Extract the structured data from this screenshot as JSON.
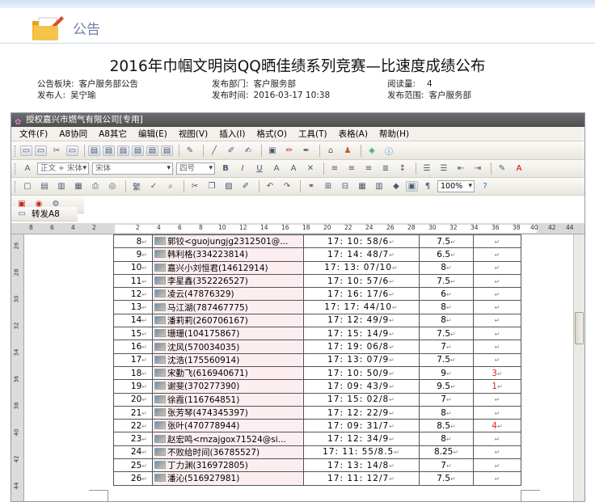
{
  "header": {
    "title": "公告"
  },
  "doc": {
    "title": "2016年巾帼文明岗QQ晒佳绩系列竞赛—比速度成绩公布",
    "meta": [
      {
        "label": "公告板块:",
        "value": "客户服务部公告"
      },
      {
        "label": "发布部门:",
        "value": "客户服务部"
      },
      {
        "label": "阅读量:",
        "value": "4"
      },
      {
        "label": "发布人:",
        "value": "吴宁瑜"
      },
      {
        "label": "发布时间:",
        "value": "2016-03-17 10:38"
      },
      {
        "label": "发布范围:",
        "value": "客户服务部"
      }
    ]
  },
  "window": {
    "title": "授权嘉兴市燃气有限公司[专用]"
  },
  "menu": [
    "文件(F)",
    "A8协同",
    "A8其它",
    "编辑(E)",
    "视图(V)",
    "插入(I)",
    "格式(O)",
    "工具(T)",
    "表格(A)",
    "帮助(H)"
  ],
  "format_bar": {
    "style": "正文 + 宋体",
    "font": "宋体",
    "size": "四号",
    "bold": "B",
    "italic": "I",
    "underline": "U",
    "font_a": "A",
    "shade_a": "A"
  },
  "standard_bar": {
    "zoom": "100%"
  },
  "a8_bar": {
    "label": "转发A8"
  },
  "ruler": {
    "labels": [
      "8",
      "6",
      "4",
      "2",
      "2",
      "4",
      "6",
      "8",
      "10",
      "12",
      "14",
      "16",
      "18",
      "20",
      "22",
      "24",
      "26",
      "28",
      "30",
      "32",
      "34",
      "36",
      "38",
      "40",
      "42",
      "44"
    ]
  },
  "vruler": {
    "labels": [
      "26",
      "28",
      "30",
      "32",
      "34",
      "36",
      "38",
      "40",
      "42",
      "44"
    ]
  },
  "table": [
    {
      "num": "8",
      "name": "郭铰<guojungjg2312501@...",
      "time": "17: 10: 58/6",
      "score": "7.5",
      "rank": ""
    },
    {
      "num": "9",
      "name": "韩利格(334223814)",
      "time": "17: 14: 48/7",
      "score": "6.5",
      "rank": ""
    },
    {
      "num": "10",
      "name": "嘉兴小刘恒君(14612914)",
      "time": "17: 13: 07/10",
      "score": "8",
      "rank": ""
    },
    {
      "num": "11",
      "name": "李星鑫(352226527)",
      "time": "17: 10: 57/6",
      "score": "7.5",
      "rank": ""
    },
    {
      "num": "12",
      "name": "凌云(47876329)",
      "time": "17: 16: 17/6",
      "score": "6",
      "rank": ""
    },
    {
      "num": "13",
      "name": "马江湖(787467775)",
      "time": "17: 17: 44/10",
      "score": "8",
      "rank": ""
    },
    {
      "num": "14",
      "name": "潘莉莉(260706167)",
      "time": "17: 12: 49/9",
      "score": "8",
      "rank": ""
    },
    {
      "num": "15",
      "name": "珊珊(104175867)",
      "time": "17: 15: 14/9",
      "score": "7.5",
      "rank": ""
    },
    {
      "num": "16",
      "name": "沈风(570034035)",
      "time": "17: 19: 06/8",
      "score": "7",
      "rank": ""
    },
    {
      "num": "17",
      "name": "沈浩(175560914)",
      "time": "17: 13: 07/9",
      "score": "7.5",
      "rank": ""
    },
    {
      "num": "18",
      "name": "宋勤飞(616940671)",
      "time": "17: 10: 50/9",
      "score": "9",
      "rank": "3"
    },
    {
      "num": "19",
      "name": "谢斐(370277390)",
      "time": "17: 09: 43/9",
      "score": "9.5",
      "rank": "1"
    },
    {
      "num": "20",
      "name": "徐霞(116764851)",
      "time": "17: 15: 02/8",
      "score": "7",
      "rank": ""
    },
    {
      "num": "21",
      "name": "张芳琴(474345397)",
      "time": "17: 12: 22/9",
      "score": "8",
      "rank": ""
    },
    {
      "num": "22",
      "name": "张叶(470778944)",
      "time": "17: 09: 31/7",
      "score": "8.5",
      "rank": "4"
    },
    {
      "num": "23",
      "name": "赵宏鸣<mzajgox71524@si...",
      "time": "17: 12: 34/9",
      "score": "8",
      "rank": ""
    },
    {
      "num": "24",
      "name": "不败给时间(36785527)",
      "time": "17: 11: 55/8.5",
      "score": "8.25",
      "rank": ""
    },
    {
      "num": "25",
      "name": "丁力渊(316972805)",
      "time": "17: 13: 14/8",
      "score": "7",
      "rank": ""
    },
    {
      "num": "26",
      "name": "潘沁(516927981)",
      "time": "17: 11: 12/7",
      "score": "7.5",
      "rank": ""
    }
  ]
}
